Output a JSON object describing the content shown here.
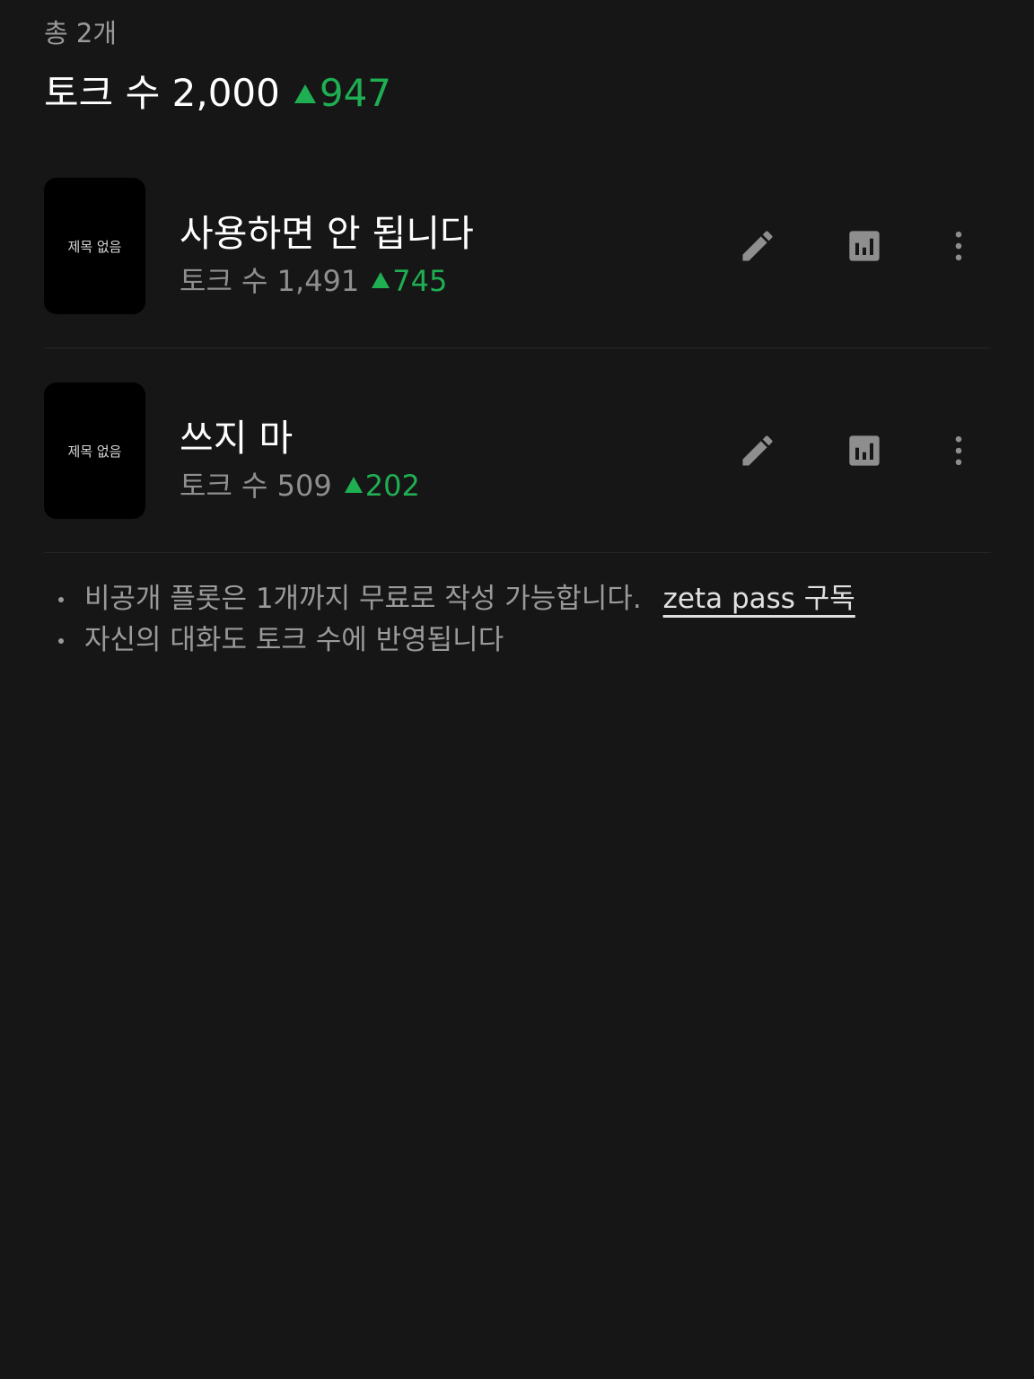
{
  "summary": {
    "count_label": "총 2개",
    "total_label": "토크 수 2,000",
    "total_delta": "947"
  },
  "items": [
    {
      "thumbnail_label": "제목 없음",
      "title": "사용하면 안 됩니다",
      "meta": "토크 수 1,491",
      "delta": "745"
    },
    {
      "thumbnail_label": "제목 없음",
      "title": "쓰지 마",
      "meta": "토크 수 509",
      "delta": "202"
    }
  ],
  "notes": {
    "line1": "비공개 플롯은 1개까지 무료로 작성 가능합니다.",
    "link": "zeta pass 구독",
    "line2": "자신의 대화도 토크 수에 반영됩니다"
  },
  "icons": {
    "edit": "pencil-icon",
    "stats": "bar-chart-icon",
    "more": "more-vertical-icon",
    "delta": "triangle-up-icon"
  },
  "colors": {
    "background": "#161616",
    "accent_green": "#1fae52",
    "icon_gray": "#8e8e8e"
  }
}
